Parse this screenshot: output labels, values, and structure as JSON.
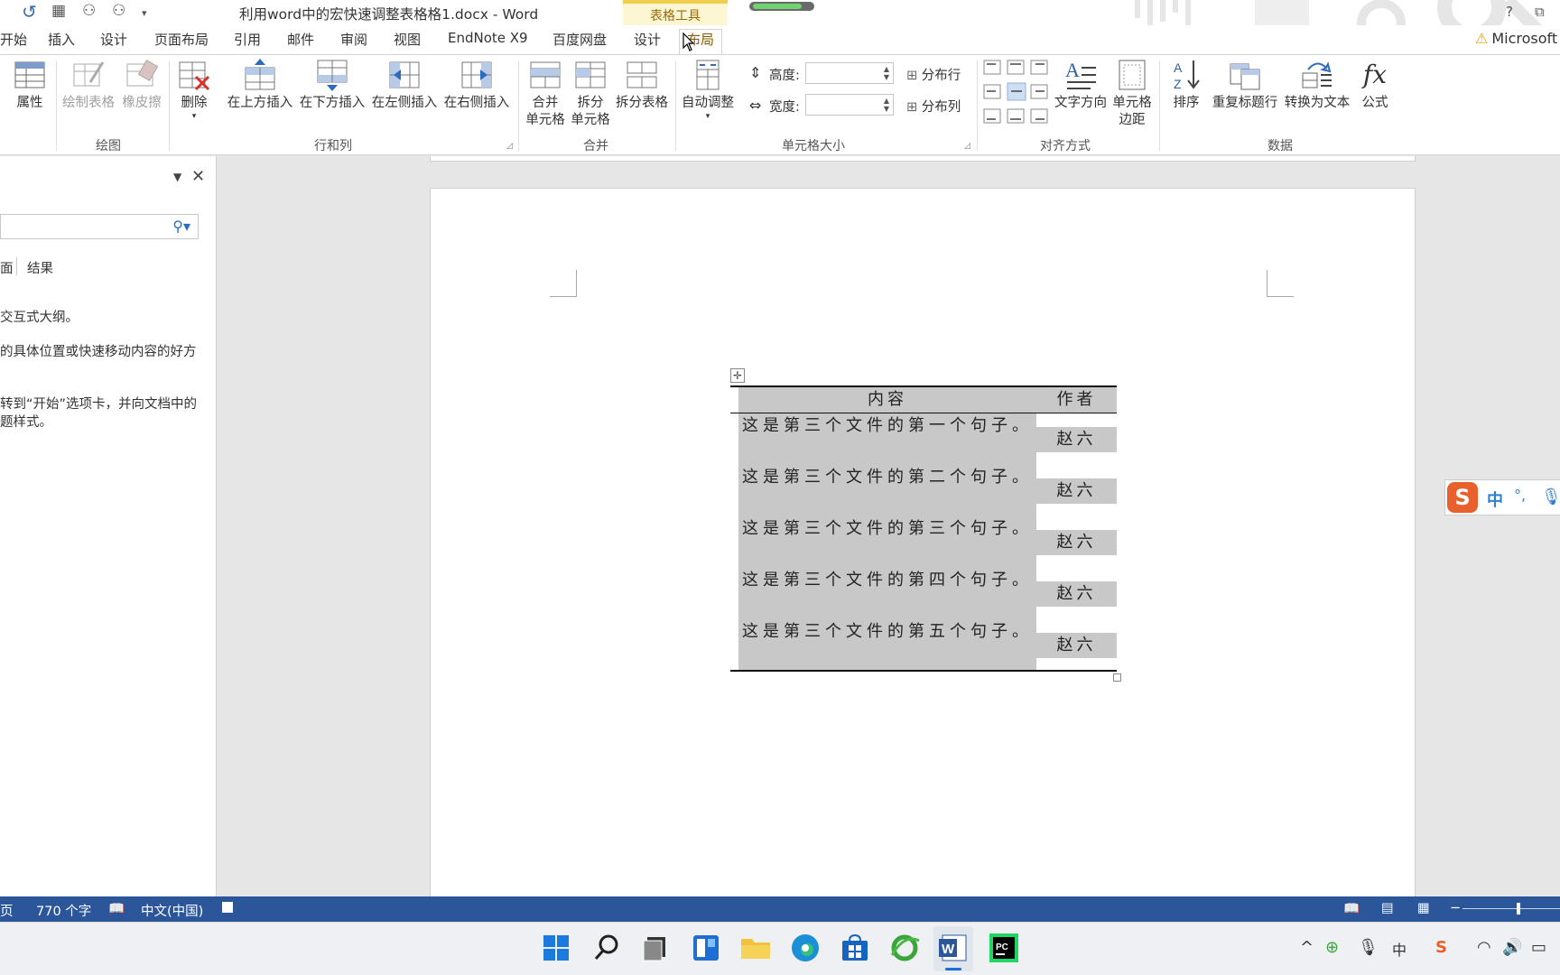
{
  "window": {
    "title": "利用word中的宏快速调整表格格1.docx - Word",
    "context_group": "表格工具",
    "help": "?",
    "restore": "⧉",
    "progress": 0.85
  },
  "quick_access": {
    "undo_icon": "undo-icon",
    "items": [
      "grid-icon",
      "org-chart-icon",
      "org-chart-icon",
      "customize-icon"
    ]
  },
  "tabs": [
    "开始",
    "插入",
    "设计",
    "页面布局",
    "引用",
    "邮件",
    "审阅",
    "视图",
    "EndNote X9",
    "百度网盘",
    "设计",
    "布局"
  ],
  "active_tab": "布局",
  "warning": {
    "icon": "warning-icon",
    "text": "Microsoft"
  },
  "ribbon": {
    "groups": {
      "draw": "绘图",
      "rows_cols": "行和列",
      "merge": "合并",
      "cell_size": "单元格大小",
      "alignment": "对齐方式",
      "data": "数据"
    },
    "buttons": {
      "properties": "属性",
      "draw_table": "绘制表格",
      "eraser": "橡皮擦",
      "delete": "删除",
      "insert_above": "在上方插入",
      "insert_below": "在下方插入",
      "insert_left": "在左侧插入",
      "insert_right": "在右侧插入",
      "merge_cells_1": "合并",
      "merge_cells_2": "单元格",
      "split_cells_1": "拆分",
      "split_cells_2": "单元格",
      "split_table": "拆分表格",
      "autofit": "自动调整",
      "height": "高度:",
      "width": "宽度:",
      "distribute_rows": "分布行",
      "distribute_cols": "分布列",
      "text_direction": "文字方向",
      "cell_margins_1": "单元格",
      "cell_margins_2": "边距",
      "sort": "排序",
      "repeat_header": "重复标题行",
      "convert_to_text": "转换为文本",
      "formula": "公式"
    },
    "height_value": "",
    "width_value": ""
  },
  "nav_pane": {
    "tabs": [
      "面",
      "结果"
    ],
    "search_placeholder": "",
    "lines": [
      "交互式大纲。",
      "的具体位置或快速移动内容的好方",
      "转到“开始”选项卡，并向文档中的",
      "题样式。"
    ]
  },
  "table": {
    "headers": [
      "内容",
      "作者"
    ],
    "rows": [
      {
        "content": "这是第三个文件的第一个句子。",
        "author": "赵六"
      },
      {
        "content": "这是第三个文件的第二个句子。",
        "author": "赵六"
      },
      {
        "content": "这是第三个文件的第三个句子。",
        "author": "赵六"
      },
      {
        "content": "这是第三个文件的第四个句子。",
        "author": "赵六"
      },
      {
        "content": "这是第三个文件的第五个句子。",
        "author": "赵六"
      }
    ]
  },
  "ime": {
    "lang": "中",
    "punct": "°,"
  },
  "status": {
    "page": "页",
    "words": "770 个字",
    "language": "中文(中国)"
  },
  "colors": {
    "accent": "#2b579a",
    "context": "#f1cd4c",
    "table_fill": "#c8c8c8"
  }
}
